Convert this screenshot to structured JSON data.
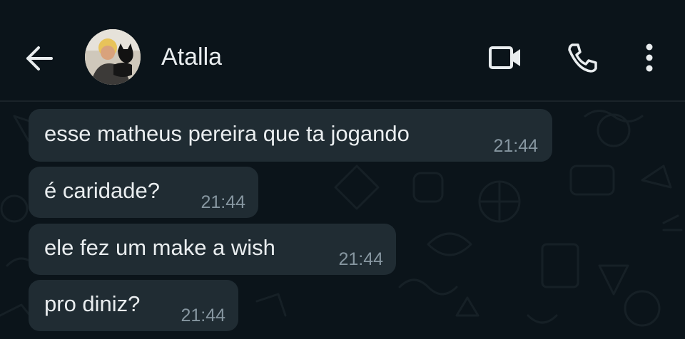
{
  "header": {
    "contact_name": "Atalla",
    "back_icon": "arrow-left-icon",
    "video_icon": "video-camera-icon",
    "call_icon": "phone-icon",
    "menu_icon": "more-vertical-icon"
  },
  "messages": [
    {
      "text": "esse matheus pereira que ta jogando",
      "time": "21:44"
    },
    {
      "text": "é caridade?",
      "time": "21:44"
    },
    {
      "text": "ele fez um make a wish",
      "time": "21:44"
    },
    {
      "text": "pro diniz?",
      "time": "21:44"
    }
  ],
  "colors": {
    "background": "#0b141a",
    "bubble_incoming": "#202c33",
    "text_primary": "#e9edef",
    "text_secondary": "#8696a0"
  }
}
